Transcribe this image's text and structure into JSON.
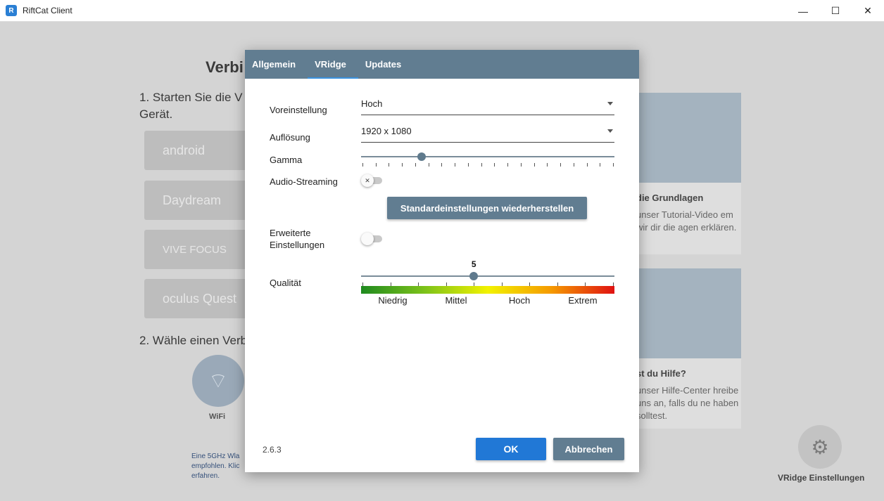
{
  "window": {
    "title": "RiftCat Client",
    "minimize_glyph": "—",
    "maximize_glyph": "☐",
    "close_glyph": "✕"
  },
  "background": {
    "heading": "Verbi",
    "step1": "1. Starten Sie die V Gerät.",
    "devices": [
      "android",
      "Daydream",
      "VIVE FOCUS",
      "oculus Quest"
    ],
    "step2": "2. Wähle einen Verb",
    "wifi_label": "WiFi",
    "note": "Eine 5GHz Wla empfohlen. Klic erfahren.",
    "card1_title": "die Grundlagen",
    "card1_text": "unser Tutorial-Video em wir dir die agen erklären.",
    "card2_title": "st du Hilfe?",
    "card2_text": "unser Hilfe-Center hreibe uns an, falls du ne haben solltest.",
    "gear_label": "VRidge Einstellungen"
  },
  "dialog": {
    "tabs": [
      {
        "label": "Allgemein",
        "active": false
      },
      {
        "label": "VRidge",
        "active": true
      },
      {
        "label": "Updates",
        "active": false
      }
    ],
    "preset": {
      "label": "Voreinstellung",
      "value": "Hoch"
    },
    "resolution": {
      "label": "Auflösung",
      "value": "1920 x 1080"
    },
    "gamma": {
      "label": "Gamma",
      "fraction": 0.24
    },
    "audio_streaming": {
      "label": "Audio-Streaming",
      "on": false
    },
    "reset_button": "Standardeinstellungen wiederherstellen",
    "advanced": {
      "label_line1": "Erweiterte",
      "label_line2": "Einstellungen",
      "on": false
    },
    "quality": {
      "label": "Qualität",
      "value": "5",
      "fraction": 0.445,
      "levels": [
        "Niedrig",
        "Mittel",
        "Hoch",
        "Extrem"
      ]
    },
    "version": "2.6.3",
    "ok_button": "OK",
    "cancel_button": "Abbrechen"
  },
  "colors": {
    "tabbar": "#617d91",
    "ok": "#2178d6",
    "tab_indicator": "#3a93e0"
  }
}
